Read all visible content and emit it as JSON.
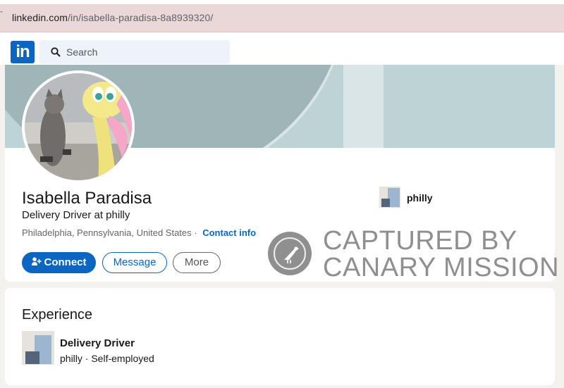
{
  "browser": {
    "url_domain": "linkedin.com",
    "url_path": "/in/isabella-paradisa-8a8939320/"
  },
  "nav": {
    "logo_text": "in",
    "search_placeholder": "Search"
  },
  "profile": {
    "name": "Isabella Paradisa",
    "headline": "Delivery Driver at philly",
    "location": "Philadelphia, Pennsylvania, United States",
    "contact_label": "Contact info",
    "current_company": "philly",
    "buttons": {
      "connect": "Connect",
      "message": "Message",
      "more": "More"
    }
  },
  "watermark": {
    "line1": "CAPTURED BY",
    "line2": "CANARY MISSION"
  },
  "experience": {
    "title": "Experience",
    "items": [
      {
        "role": "Delivery Driver",
        "company_line": "philly · Self-employed"
      }
    ]
  },
  "colors": {
    "linkedin_blue": "#0a66c2",
    "banner": "#9fb5b8",
    "watermark_gray": "#8f8f8f"
  },
  "icons": [
    "search-icon",
    "add-person-icon",
    "canary-bird-icon"
  ]
}
